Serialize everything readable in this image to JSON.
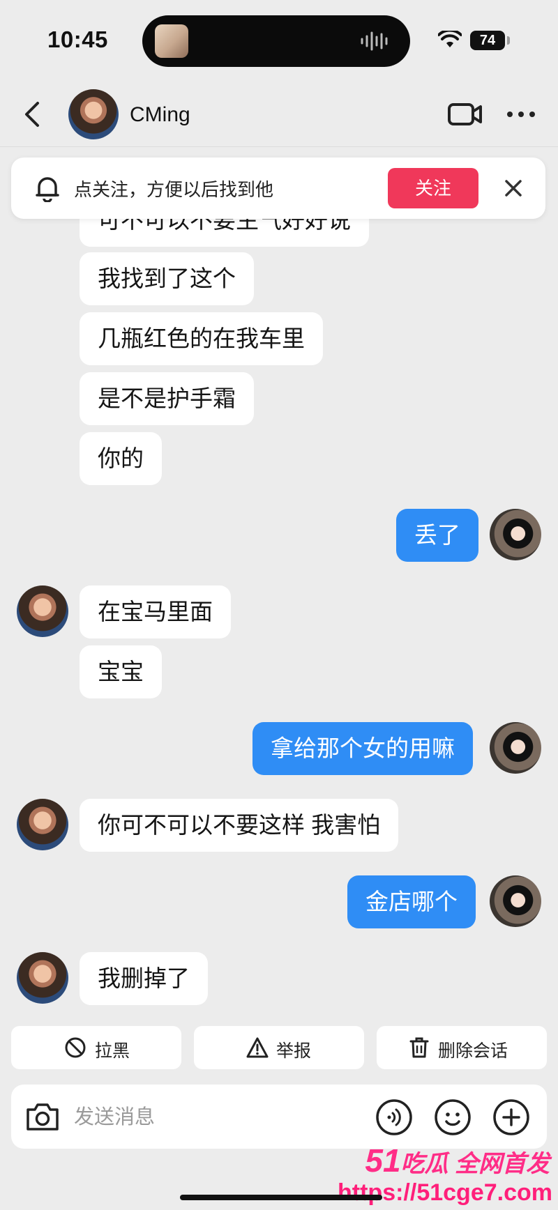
{
  "status_bar": {
    "time": "10:45",
    "battery": "74"
  },
  "header": {
    "title": "CMing"
  },
  "follow_banner": {
    "text": "点关注，方便以后找到他",
    "button": "关注"
  },
  "messages": [
    {
      "side": "in",
      "text": "可不可以不要生气好好说",
      "avatar": false
    },
    {
      "side": "in",
      "text": "我找到了这个",
      "avatar": false
    },
    {
      "side": "in",
      "text": "几瓶红色的在我车里",
      "avatar": false
    },
    {
      "side": "in",
      "text": "是不是护手霜",
      "avatar": false
    },
    {
      "side": "in",
      "text": "你的",
      "avatar": false
    },
    {
      "side": "out",
      "text": "丢了",
      "avatar": true
    },
    {
      "side": "in",
      "text": "在宝马里面",
      "avatar": true
    },
    {
      "side": "in",
      "text": "宝宝",
      "avatar": false
    },
    {
      "side": "out",
      "text": "拿给那个女的用嘛",
      "avatar": true
    },
    {
      "side": "in",
      "text": "你可不可以不要这样 我害怕",
      "avatar": true
    },
    {
      "side": "out",
      "text": "金店哪个",
      "avatar": true
    },
    {
      "side": "in",
      "text": "我删掉了",
      "avatar": true
    }
  ],
  "actions": {
    "block": "拉黑",
    "report": "举报",
    "delete": "删除会话"
  },
  "composer": {
    "placeholder": "发送消息"
  },
  "watermark": {
    "brand_num": "51",
    "brand_text": "吃瓜 全网首发",
    "url": "https://51cge7.com"
  },
  "colors": {
    "accent_blue": "#2f8df5",
    "follow_red": "#f0385a",
    "watermark_pink": "#ff2d87"
  }
}
